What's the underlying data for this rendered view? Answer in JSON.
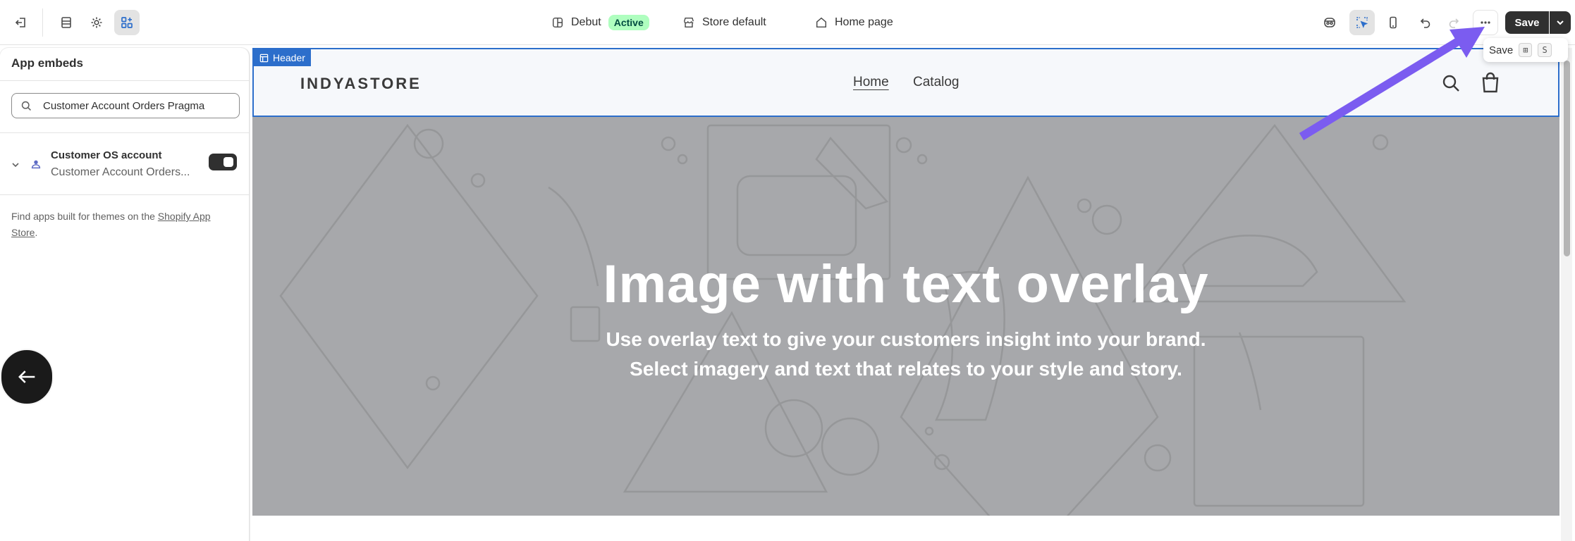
{
  "topbar": {
    "theme_name": "Debut",
    "theme_status": "Active",
    "store": "Store default",
    "page": "Home page",
    "save_label": "Save"
  },
  "tooltip": {
    "label": "Save",
    "key1": "⊞",
    "key2": "S"
  },
  "sidebar": {
    "title": "App embeds",
    "search_value": "Customer Account Orders Pragma",
    "embed": {
      "title": "Customer OS account",
      "subtitle": "Customer Account Orders..."
    },
    "find_text": "Find apps built for themes on the ",
    "find_link": "Shopify App Store",
    "find_end": "."
  },
  "preview": {
    "header_tag": "Header",
    "logo": "INDYASTORE",
    "nav": [
      "Home",
      "Catalog"
    ],
    "hero_title": "Image with text overlay",
    "hero_sub1": "Use overlay text to give your customers insight into your brand.",
    "hero_sub2": "Select imagery and text that relates to your style and story."
  },
  "colors": {
    "accent_blue": "#2c6ecb",
    "annotation_arrow": "#7b5cf0",
    "badge_green": "#affebf",
    "hero_gray": "#a7a8ab"
  },
  "icons": [
    "exit-icon",
    "sections-icon",
    "gear-icon",
    "app-embeds-icon",
    "layout-icon",
    "store-icon",
    "home-icon",
    "inspector-icon",
    "select-icon",
    "mobile-icon",
    "undo-icon",
    "redo-icon",
    "more-icon",
    "chevron-down-icon",
    "search-icon",
    "person-icon",
    "arrow-left-icon",
    "cart-icon"
  ]
}
